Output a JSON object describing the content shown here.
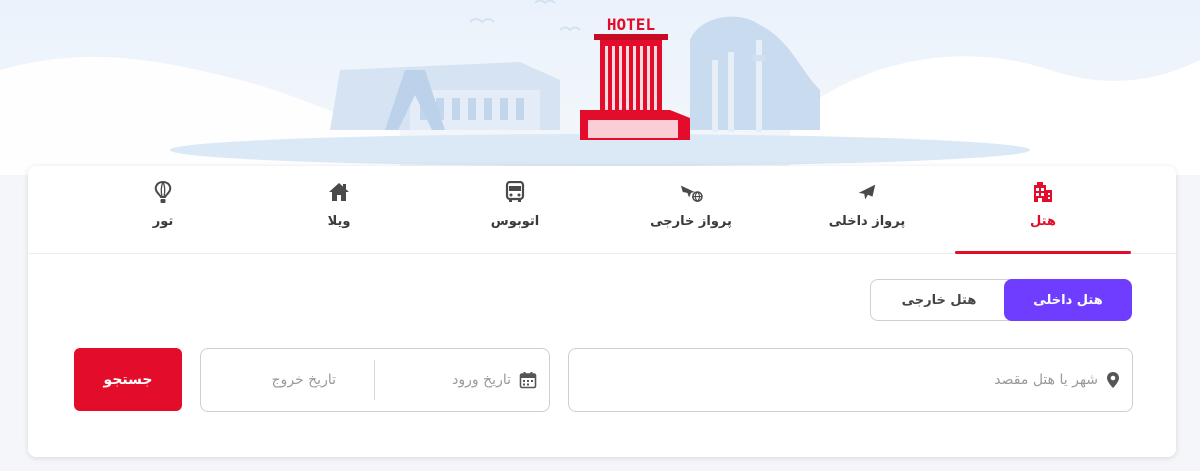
{
  "hero": {
    "sign_text": "HOTEL"
  },
  "tabs": [
    {
      "id": "hotel",
      "label": "هتل",
      "icon": "hotel-building-icon",
      "active": true
    },
    {
      "id": "domestic-flight",
      "label": "پرواز داخلی",
      "icon": "airplane-icon",
      "active": false
    },
    {
      "id": "international-flight",
      "label": "پرواز خارجی",
      "icon": "airplane-globe-icon",
      "active": false
    },
    {
      "id": "bus",
      "label": "اتوبوس",
      "icon": "bus-icon",
      "active": false
    },
    {
      "id": "villa",
      "label": "ویلا",
      "icon": "house-icon",
      "active": false
    },
    {
      "id": "tour",
      "label": "تور",
      "icon": "hot-air-balloon-icon",
      "active": false
    }
  ],
  "hotel_type": {
    "options": [
      {
        "label": "هتل داخلی",
        "selected": true
      },
      {
        "label": "هتل خارجی",
        "selected": false
      }
    ]
  },
  "search": {
    "destination_placeholder": "شهر یا هتل مقصد",
    "checkin_placeholder": "تاریخ ورود",
    "checkout_placeholder": "تاریخ خروج",
    "button_label": "جستجو"
  },
  "colors": {
    "brand_red": "#e30d2b",
    "toggle_purple": "#6f3dff",
    "icon_gray": "#4a4a4a"
  }
}
